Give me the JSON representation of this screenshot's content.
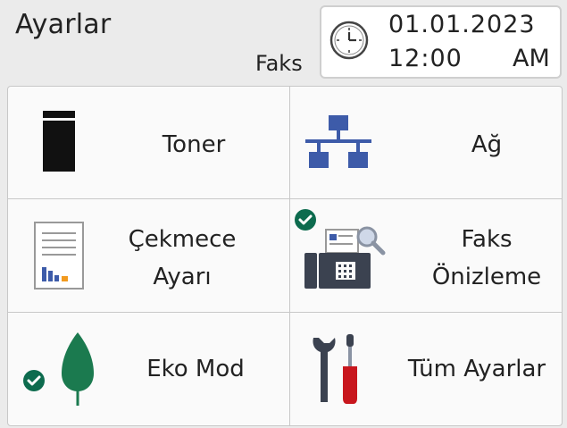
{
  "header": {
    "title": "Ayarlar",
    "mode": "Faks",
    "date": "01.01.2023",
    "time": "12:00",
    "ampm": "AM"
  },
  "tiles": [
    {
      "label": "Toner",
      "icon": "toner-cartridge-icon"
    },
    {
      "label": "Ağ",
      "icon": "network-icon"
    },
    {
      "label_line1": "Çekmece",
      "label_line2": "Ayarı",
      "icon": "tray-settings-icon"
    },
    {
      "label_line1": "Faks",
      "label_line2": "Önizleme",
      "icon": "fax-preview-icon",
      "status": "on"
    },
    {
      "label": "Eko Mod",
      "icon": "eco-leaf-icon",
      "status": "on"
    },
    {
      "label": "Tüm Ayarlar",
      "icon": "tools-icon"
    }
  ],
  "colors": {
    "status_green": "#0d6b4e",
    "network_blue": "#3d5ba9",
    "leaf_green": "#1b7a4f",
    "screwdriver_red": "#c8161d"
  }
}
